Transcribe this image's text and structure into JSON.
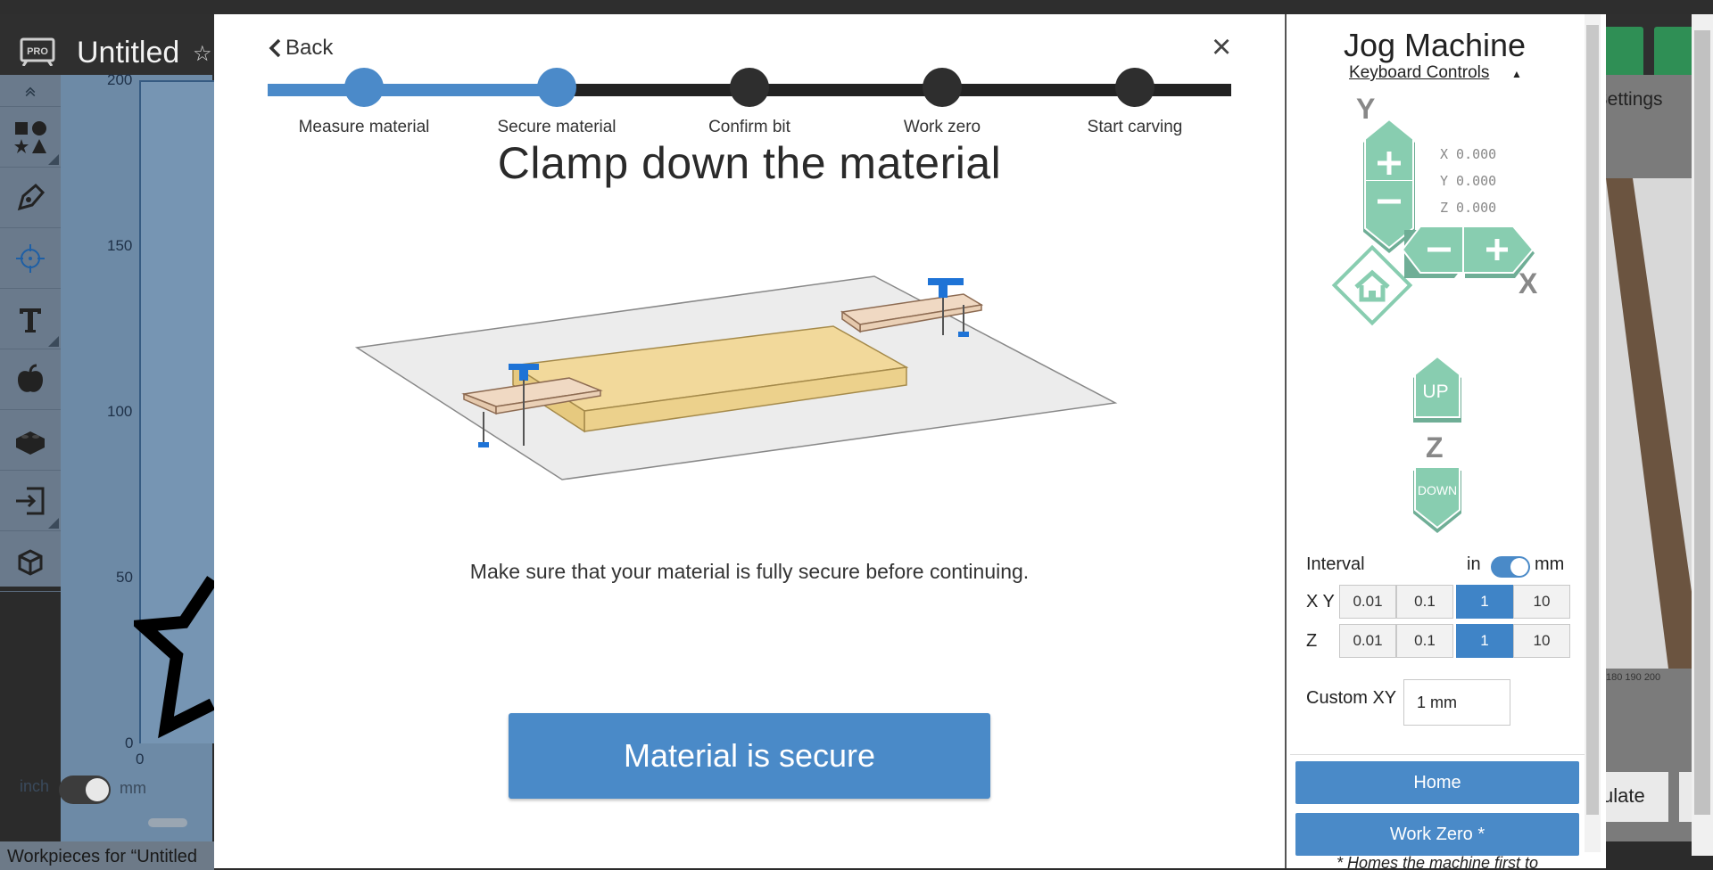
{
  "app": {
    "title": "Untitled",
    "workpieces_text": "Workpieces for “Untitled",
    "unit_inch": "inch",
    "unit_mm": "mm",
    "ruler_y": [
      "200",
      "150",
      "100",
      "50",
      "0"
    ],
    "ruler_x0": "0",
    "right_settings": "t Settings",
    "right_ruler": "180  190  200",
    "right_simulate": "ulate",
    "pro_badge": "PRO"
  },
  "modal": {
    "back_label": "Back",
    "close_label": "×",
    "steps": [
      {
        "label": "Measure material",
        "done": true
      },
      {
        "label": "Secure material",
        "done": true
      },
      {
        "label": "Confirm bit",
        "done": false
      },
      {
        "label": "Work zero",
        "done": false
      },
      {
        "label": "Start carving",
        "done": false
      }
    ],
    "title": "Clamp down the material",
    "instruction": "Make sure that your material is fully secure before continuing.",
    "confirm_label": "Material is secure"
  },
  "jog": {
    "title": "Jog Machine",
    "keyboard_controls": "Keyboard Controls",
    "axis": {
      "x": "X",
      "y": "Y",
      "z": "Z"
    },
    "coords": {
      "x": "X 0.000",
      "y": "Y 0.000",
      "z": "Z 0.000"
    },
    "up_label": "UP",
    "down_label": "DOWN",
    "interval": {
      "label": "Interval",
      "unit_in": "in",
      "unit_mm": "mm",
      "selected_unit": "mm",
      "xy_label": "X Y",
      "z_label": "Z",
      "options": [
        "0.01",
        "0.1",
        "1",
        "10"
      ],
      "xy_selected": "1",
      "z_selected": "1"
    },
    "custom_xy_label": "Custom XY",
    "custom_xy_value": "1 mm",
    "home_label": "Home",
    "work_zero_label": "Work Zero *",
    "home_note": "* Homes the machine first to"
  },
  "colors": {
    "accent": "#4a8ac8",
    "jog_key": "#88cdb0",
    "jog_key_dark": "#6fae96"
  }
}
